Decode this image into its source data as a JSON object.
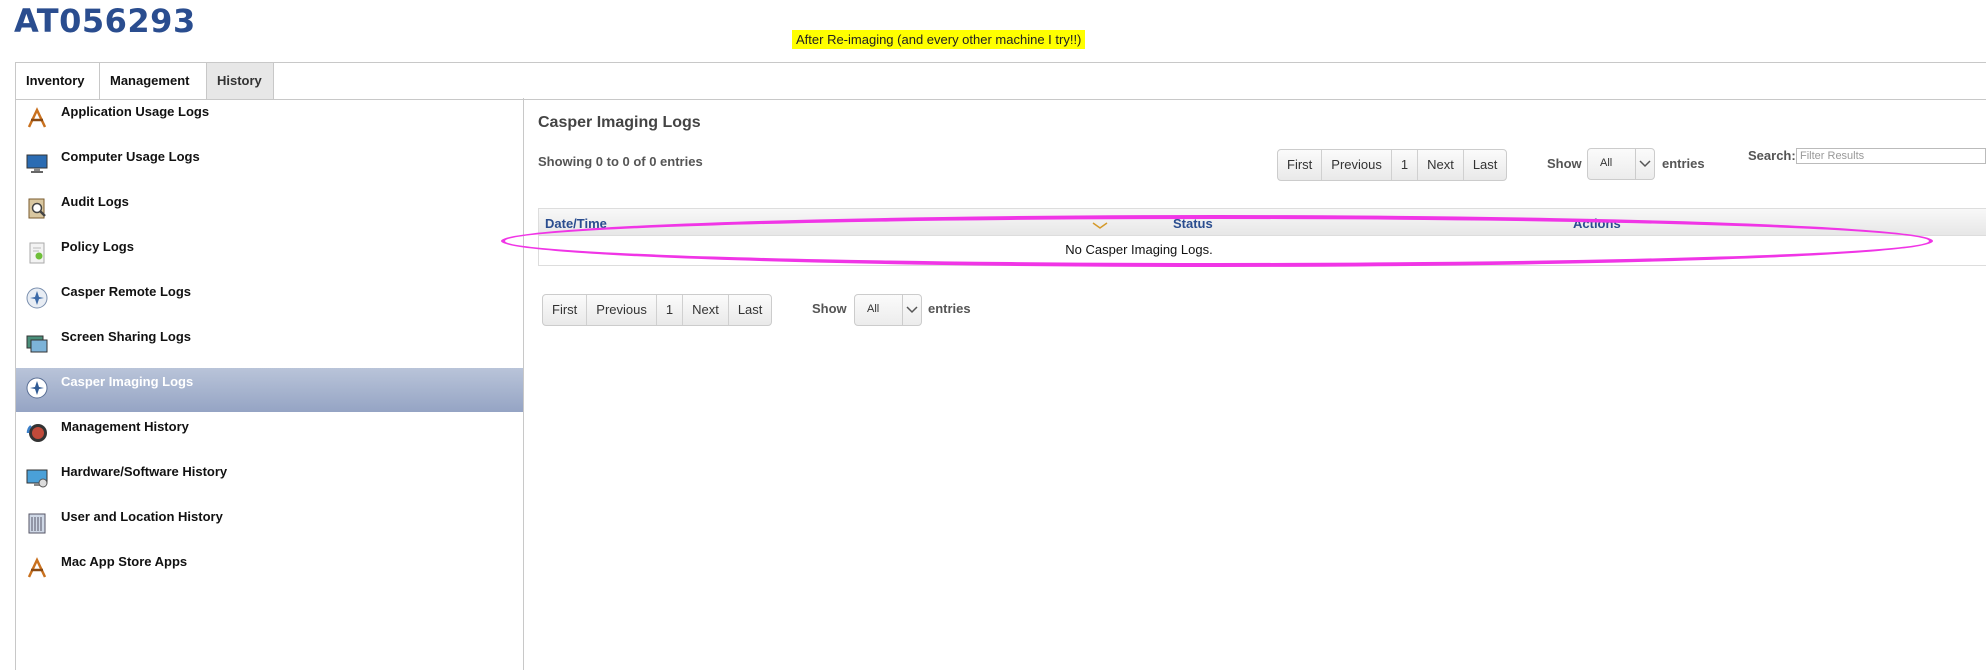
{
  "computer_name": "AT056293",
  "annotation_note": "After Re-imaging (and every other machine I try!!)",
  "tabs": [
    {
      "label": "Inventory",
      "active": false
    },
    {
      "label": "Management",
      "active": false
    },
    {
      "label": "History",
      "active": true
    }
  ],
  "sidebar": {
    "items": [
      {
        "label": "Application Usage Logs",
        "icon": "app-store-icon"
      },
      {
        "label": "Computer Usage Logs",
        "icon": "monitor-icon"
      },
      {
        "label": "Audit Logs",
        "icon": "magnifier-clipboard-icon"
      },
      {
        "label": "Policy Logs",
        "icon": "policy-document-icon"
      },
      {
        "label": "Casper Remote Logs",
        "icon": "casper-remote-icon"
      },
      {
        "label": "Screen Sharing Logs",
        "icon": "screen-sharing-icon"
      },
      {
        "label": "Casper Imaging Logs",
        "icon": "casper-imaging-icon",
        "active": true
      },
      {
        "label": "Management History",
        "icon": "management-history-icon"
      },
      {
        "label": "Hardware/Software History",
        "icon": "hardware-software-icon"
      },
      {
        "label": "User and Location History",
        "icon": "building-icon"
      },
      {
        "label": "Mac App Store Apps",
        "icon": "app-store-icon"
      }
    ],
    "active_color": "#a6b3cf"
  },
  "main": {
    "title": "Casper Imaging Logs",
    "showing_text": "Showing 0 to 0 of 0 entries",
    "pagination": {
      "first": "First",
      "previous": "Previous",
      "page": "1",
      "next": "Next",
      "last": "Last"
    },
    "show_label": "Show",
    "show_value": "All",
    "entries_label": "entries",
    "search_label": "Search:",
    "search_placeholder": "Filter Results",
    "table": {
      "columns": [
        "Date/Time",
        "Status",
        "Actions"
      ],
      "empty_message": "No Casper Imaging Logs."
    }
  },
  "colors": {
    "title_blue": "#2a4d8f",
    "annotation_highlight": "#ffff00",
    "ellipse_magenta": "#f035e6"
  }
}
